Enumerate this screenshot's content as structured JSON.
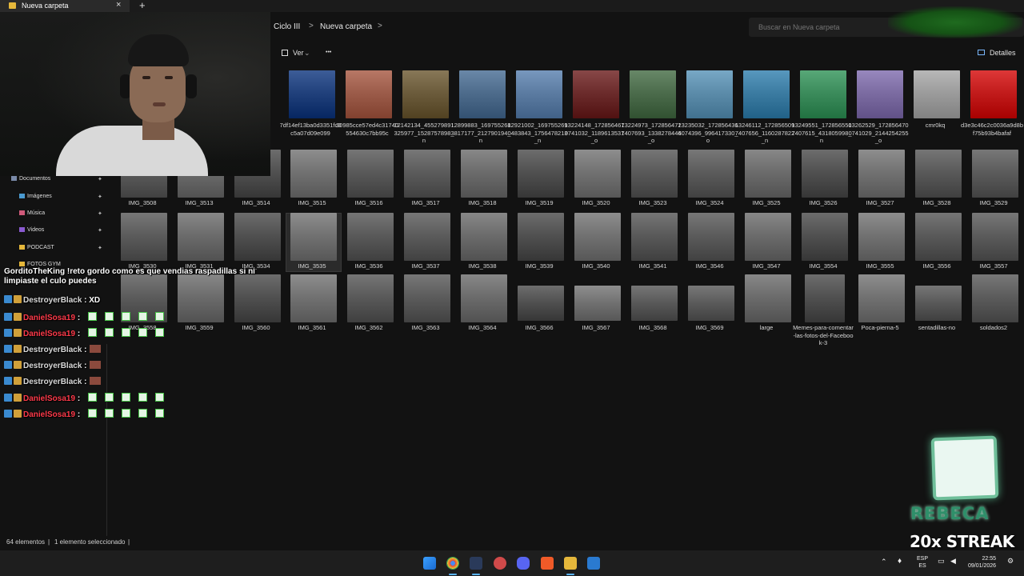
{
  "window": {
    "tab_label": "Nueva carpeta",
    "close_glyph": "×",
    "new_tab_glyph": "+"
  },
  "nav": {
    "breadcrumbs": [
      "Ciclo III",
      "Nueva carpeta"
    ],
    "separator": ">",
    "search_placeholder": "Buscar en Nueva carpeta"
  },
  "toolbar": {
    "view_label": "Ver",
    "more_label": "•••",
    "details_label": "Detalles"
  },
  "sidebar": {
    "items": [
      "Documentos",
      "Imágenes",
      "Música",
      "Videos",
      "PODCAST",
      "FOTOS GYM"
    ]
  },
  "files": {
    "row1": [
      {
        "name": "7df14ef13ba0d3351fc0c5a07d09e099",
        "color": "#1f3f7a"
      },
      {
        "name": "30985cce57ed4c31740554630c7bb95c",
        "color": "#9a5a48"
      },
      {
        "name": "12142134_455279891325977_1528757898_n",
        "color": "#6a5a3a"
      },
      {
        "name": "12899883_1697552683817177_212790194_n",
        "color": "#4c6a8a"
      },
      {
        "name": "12921002_1697552690483843_1756478213_n",
        "color": "#5a7aa0"
      },
      {
        "name": "13224148_1728564670741032_1189613531_o",
        "color": "#6a2a2a"
      },
      {
        "name": "13224973_1728564727407693_1338278446_o",
        "color": "#4a6a4a"
      },
      {
        "name": "13235032_1728564364074396_996417330_o",
        "color": "#5a8aa8"
      },
      {
        "name": "13246112_1728565097407656_1160287822_n",
        "color": "#3a7aa0"
      },
      {
        "name": "13249551_1728565507407615_431805998_n",
        "color": "#3a8a5a"
      },
      {
        "name": "13262529_1728564700741029_2144254255_o",
        "color": "#7a6aa0"
      },
      {
        "name": "cmr0kq",
        "color": "#9a9a9a"
      },
      {
        "name": "d3e3c46c2c0036a9d8bf75b93b4bafaf",
        "color": "#c01a1a"
      }
    ],
    "row2": [
      "IMG_3508",
      "IMG_3513",
      "IMG_3514",
      "IMG_3515",
      "IMG_3516",
      "IMG_3517",
      "IMG_3518",
      "IMG_3519",
      "IMG_3520",
      "IMG_3523",
      "IMG_3524",
      "IMG_3525",
      "IMG_3526",
      "IMG_3527",
      "IMG_3528",
      "IMG_3529"
    ],
    "row3": [
      "IMG_3530",
      "IMG_3531",
      "IMG_3534",
      "IMG_3535",
      "IMG_3536",
      "IMG_3537",
      "IMG_3538",
      "IMG_3539",
      "IMG_3540",
      "IMG_3541",
      "IMG_3546",
      "IMG_3547",
      "IMG_3554",
      "IMG_3555",
      "IMG_3556",
      "IMG_3557"
    ],
    "row4": [
      "IMG_3558",
      "IMG_3559",
      "IMG_3560",
      "IMG_3561",
      "IMG_3562",
      "IMG_3563",
      "IMG_3564",
      "IMG_3566",
      "IMG_3567",
      "IMG_3568",
      "IMG_3569",
      "large",
      "Memes-para-comentar-las-fotos-del-Facebook-3",
      "Poca-pierna-5",
      "sentadillas-no",
      "soldados2"
    ]
  },
  "chat": {
    "lines": [
      {
        "user": "GorditoTheKing",
        "text": " !reto gordo como es que vendias raspadillas si ni limpiaste el culo puedes",
        "user_color": "#ffffff"
      },
      {
        "user": "DestroyerBlack",
        "text": " : XD",
        "user_color": "#d9d9d9"
      },
      {
        "user": "DanielSosa19",
        "text": " :",
        "user_color": "#ff3a4a"
      },
      {
        "user": "DanielSosa19",
        "text": " :",
        "user_color": "#ff3a4a"
      },
      {
        "user": "DestroyerBlack",
        "text": " :",
        "user_color": "#d9d9d9"
      },
      {
        "user": "DestroyerBlack",
        "text": " :",
        "user_color": "#d9d9d9"
      },
      {
        "user": "DestroyerBlack",
        "text": " :",
        "user_color": "#d9d9d9"
      },
      {
        "user": "DanielSosa19",
        "text": " :",
        "user_color": "#ff3a4a"
      },
      {
        "user": "DanielSosa19",
        "text": " :",
        "user_color": "#ff3a4a"
      }
    ]
  },
  "status": {
    "count": "64 elementos",
    "selected": "1 elemento seleccionado",
    "separator": "|"
  },
  "overlay": {
    "rebeca": "REBECA",
    "streak": "20x STREAK"
  },
  "taskbar": {
    "lang_top": "ESP",
    "lang_bottom": "ES",
    "time": "22:55",
    "date": "09/01/2026"
  }
}
